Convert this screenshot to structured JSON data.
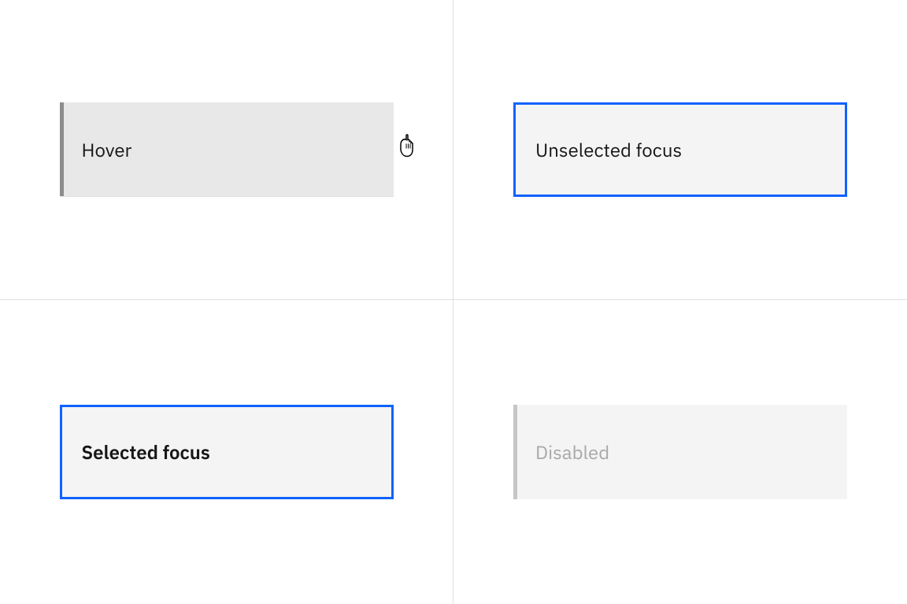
{
  "states": {
    "hover": {
      "label": "Hover"
    },
    "unselected_focus": {
      "label": "Unselected focus"
    },
    "selected_focus": {
      "label": "Selected focus"
    },
    "disabled": {
      "label": "Disabled"
    }
  },
  "icons": {
    "pointer": "pointer-cursor-icon"
  },
  "colors": {
    "focus": "#0f62fe",
    "hover_bg": "#e8e8e8",
    "bg": "#f4f4f4",
    "border": "#e0e0e0",
    "text": "#161616",
    "disabled_text": "#a8a8a8",
    "hover_indicator": "#8d8d8d",
    "disabled_indicator": "#c6c6c6"
  }
}
